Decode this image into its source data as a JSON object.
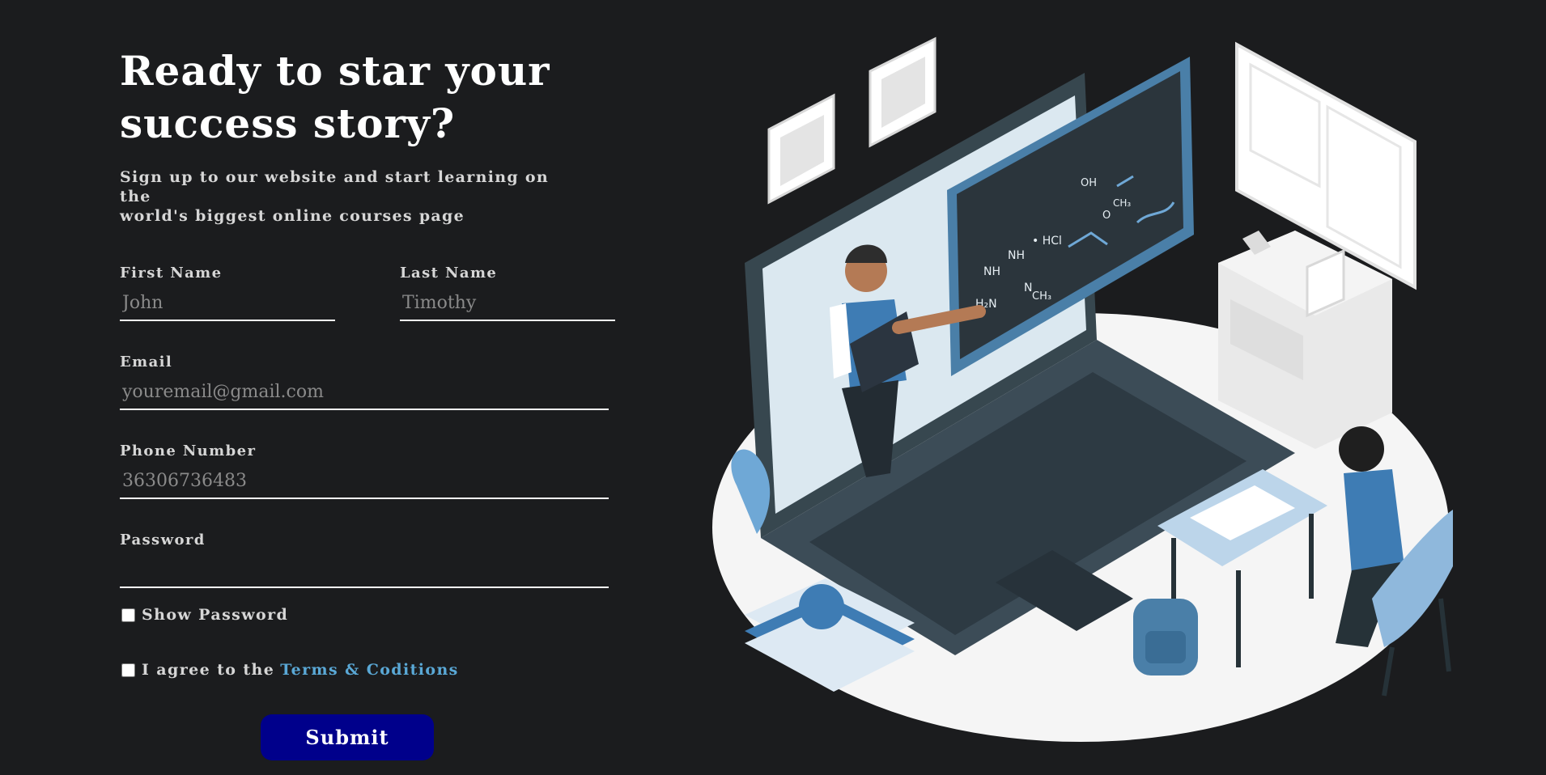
{
  "hero": {
    "headline_line1": "Ready to star your",
    "headline_line2": "success story?",
    "subtitle_line1": "Sign up to our website and start learning on the",
    "subtitle_line2": "world's biggest online courses page"
  },
  "form": {
    "first_name": {
      "label": "First Name",
      "placeholder": "John",
      "value": ""
    },
    "last_name": {
      "label": "Last Name",
      "placeholder": "Timothy",
      "value": ""
    },
    "email": {
      "label": "Email",
      "placeholder": "youremail@gmail.com",
      "value": ""
    },
    "phone": {
      "label": "Phone Number",
      "placeholder": "36306736483",
      "value": ""
    },
    "password": {
      "label": "Password",
      "placeholder": "",
      "value": ""
    },
    "show_password": {
      "label": "Show Password",
      "checked": false
    },
    "terms": {
      "prefix": "I agree to the",
      "link": "Terms & Coditions",
      "checked": false
    },
    "submit_label": "Submit"
  },
  "illustration": {
    "icon": "online-learning-illustration",
    "chalkboard_lines": [
      "NH",
      "NH",
      "• HCl",
      "H₂N",
      "N",
      "CH₃",
      "OH",
      "O",
      "CH₃"
    ]
  },
  "colors": {
    "background": "#1b1c1e",
    "submit_bg": "#00008b",
    "link": "#5aa8d6"
  }
}
